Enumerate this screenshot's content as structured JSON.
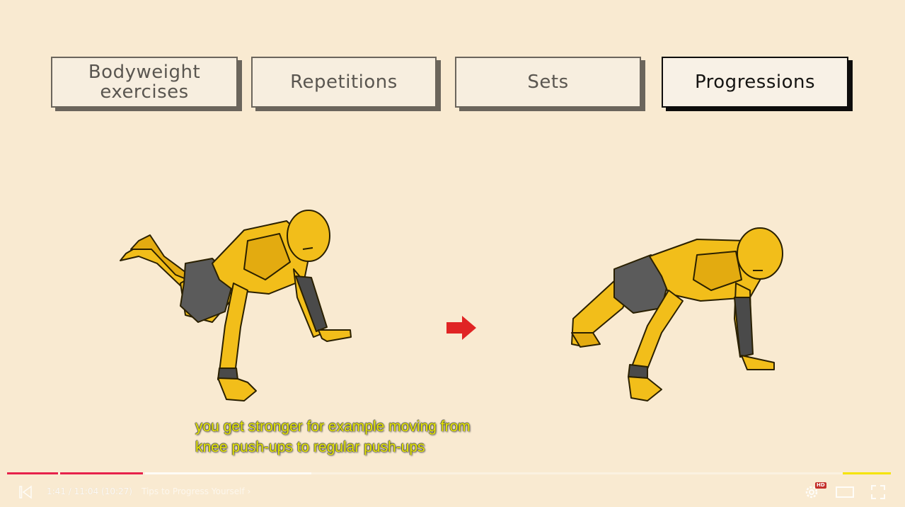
{
  "tabs": [
    {
      "label": "Bodyweight\nexercises",
      "active": false
    },
    {
      "label": "Repetitions",
      "active": false
    },
    {
      "label": "Sets",
      "active": false
    },
    {
      "label": "Progressions",
      "active": true
    }
  ],
  "figures": {
    "left": "knee-push-up-figure",
    "arrow": "right-arrow-icon",
    "right": "push-up-figure",
    "arrow_color": "#e02424",
    "skin_color": "#f2be1a",
    "shorts_color": "#5b5b5b"
  },
  "captions": {
    "line1": "you get stronger for example moving from",
    "line2": "knee push-ups to regular push-ups",
    "color": "#e6e600"
  },
  "player": {
    "progress_played_fraction": 0.154,
    "played_color": "#e7224b",
    "sponsor_color": "#f5e400",
    "time_text": "1:41 / 11:04",
    "adjusted_time": "(10:27)",
    "chapter_text": "Tips to Progress Yourself",
    "icons": [
      "previous-icon",
      "settings-icon",
      "theater-icon",
      "fullscreen-icon"
    ],
    "hd_badge": "HD"
  }
}
